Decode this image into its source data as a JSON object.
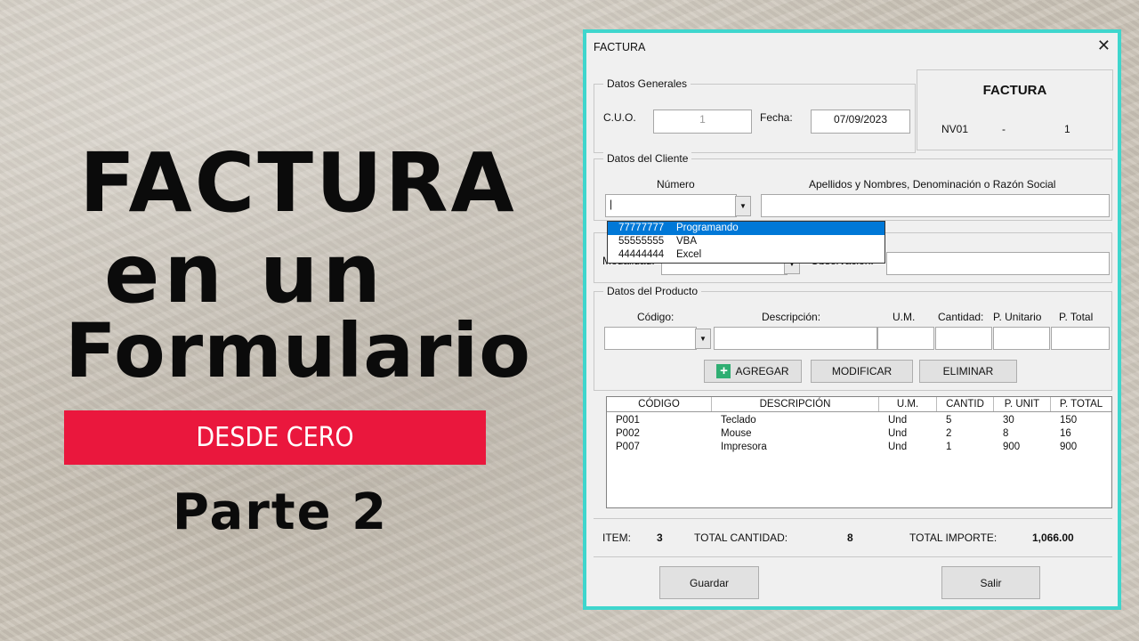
{
  "title": {
    "line1": "FACTURA",
    "line2": "en un",
    "line3": "Formulario",
    "banner": "DESDE CERO",
    "line4": "Parte 2"
  },
  "window": {
    "title": "FACTURA",
    "close": "✕",
    "general": {
      "legend": "Datos Generales",
      "cuo_label": "C.U.O.",
      "cuo_value": "1",
      "fecha_label": "Fecha:",
      "fecha_value": "07/09/2023"
    },
    "invoice_box": {
      "heading": "FACTURA",
      "series": "NV01",
      "dash": "-",
      "number": "1"
    },
    "client": {
      "legend": "Datos del Cliente",
      "numero_label": "Número",
      "nombre_label": "Apellidos y Nombres, Denominación o Razón Social",
      "numero_value": "|",
      "dropdown": [
        {
          "code": "77777777",
          "name": "Programando"
        },
        {
          "code": "55555555",
          "name": "VBA"
        },
        {
          "code": "44444444",
          "name": "Excel"
        }
      ]
    },
    "payment": {
      "modalidad_label": "Modalidad:",
      "observacion_label": "Observación:"
    },
    "product": {
      "legend": "Datos del Producto",
      "codigo_label": "Código:",
      "descripcion_label": "Descripción:",
      "um_label": "U.M.",
      "cantidad_label": "Cantidad:",
      "punit_label": "P. Unitario",
      "ptotal_label": "P. Total"
    },
    "buttons": {
      "agregar": "AGREGAR",
      "modificar": "MODIFICAR",
      "eliminar": "ELIMINAR",
      "guardar": "Guardar",
      "salir": "Salir"
    },
    "table": {
      "headers": [
        "CÓDIGO",
        "DESCRIPCIÓN",
        "U.M.",
        "CANTID",
        "P. UNIT",
        "P. TOTAL"
      ],
      "rows": [
        [
          "P001",
          "Teclado",
          "Und",
          "5",
          "30",
          "150"
        ],
        [
          "P002",
          "Mouse",
          "Und",
          "2",
          "8",
          "16"
        ],
        [
          "P007",
          "Impresora",
          "Und",
          "1",
          "900",
          "900"
        ]
      ]
    },
    "totals": {
      "item_label": "ITEM:",
      "item_value": "3",
      "cantidad_label": "TOTAL CANTIDAD:",
      "cantidad_value": "8",
      "importe_label": "TOTAL IMPORTE:",
      "importe_value": "1,066.00"
    }
  },
  "colors": {
    "banner": "#ea173d",
    "window_border": "#3fd6cd",
    "selection": "#0078d7"
  }
}
